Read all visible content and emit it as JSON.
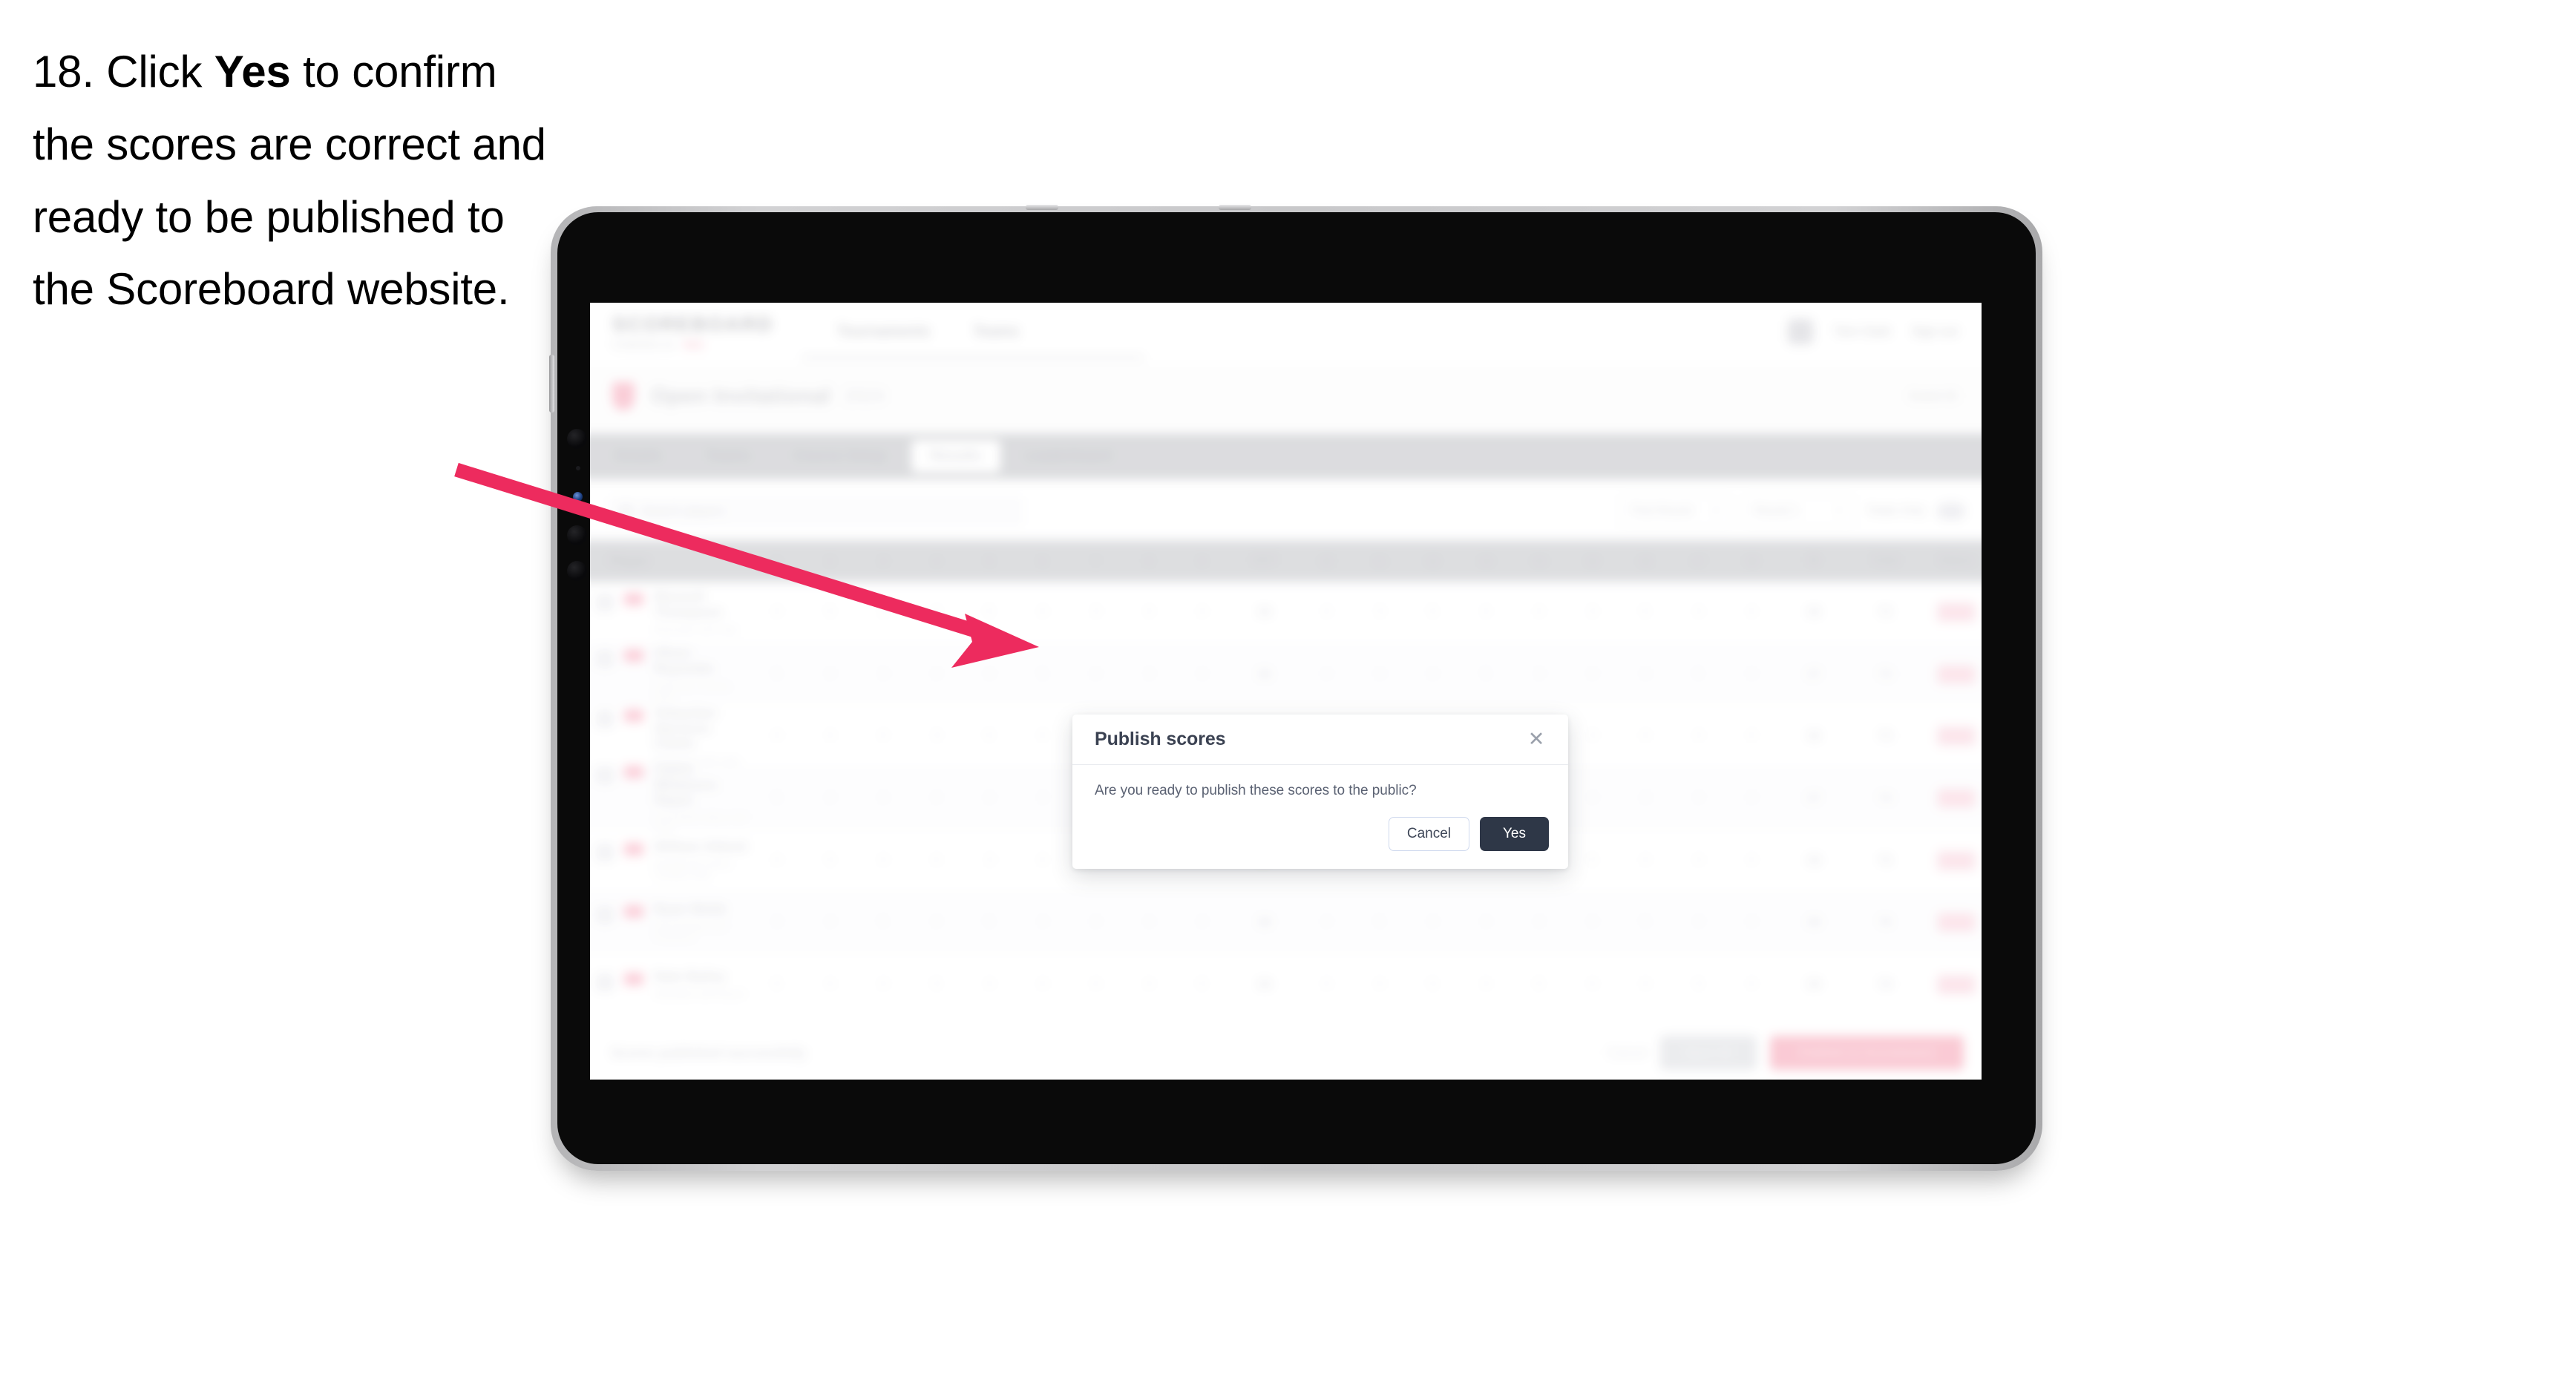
{
  "instruction": {
    "number": "18.",
    "before": " Click ",
    "bold": "Yes",
    "after": " to confirm the scores are correct and ready to be published to the Scoreboard website."
  },
  "annotation": {
    "arrow_color": "#ED2B5E",
    "points_to": "publish-scores-modal"
  },
  "device": {
    "type": "tablet",
    "bezel_color": "#0a0a0a",
    "frame_color": "#c8c8ca"
  },
  "app": {
    "nav": {
      "logo": "SCOREBOARD",
      "logo_sub": "POWERED BY",
      "logo_sub_accent": "RED",
      "links": [
        "Tournaments",
        "Teams"
      ],
      "user": "Tom Clark",
      "sign_out": "Sign out"
    },
    "page_title": {
      "title": "Open Invitational",
      "badge": "2024",
      "right_label": "Event ID"
    },
    "tabs": [
      {
        "label": "Details",
        "active": false
      },
      {
        "label": "Teams",
        "active": false
      },
      {
        "label": "Course Setup",
        "active": false
      },
      {
        "label": "Results",
        "active": true
      },
      {
        "label": "Leaderboard",
        "active": false
      }
    ],
    "filter_bar": {
      "search_placeholder": "Search players",
      "selects": [
        {
          "label": "First Round"
        },
        {
          "label": "Round 1"
        }
      ],
      "toggle_label": "Totals Only"
    },
    "table": {
      "columns": [
        "Player",
        "1",
        "2",
        "3",
        "4",
        "5",
        "6",
        "7",
        "8",
        "9",
        "OUT",
        "10",
        "11",
        "12",
        "13",
        "14",
        "15",
        "16",
        "17",
        "18",
        "IN",
        "Total",
        "Status"
      ],
      "rows": [
        {
          "player": "Maxwell Thompson",
          "club": "Riverside Golf Club",
          "scores": [
            "4",
            "5",
            "3",
            "4",
            "5",
            "4",
            "3",
            "4",
            "4"
          ],
          "out": "36",
          "scores_in": [
            "4",
            "3",
            "5",
            "4",
            "4",
            "3",
            "5",
            "4",
            "4"
          ],
          "in": "36",
          "total": "72",
          "status": "Final"
        },
        {
          "player": "Oliver Reynolds",
          "club": "Lakeview Country Club",
          "scores": [
            "5",
            "4",
            "3",
            "4",
            "4",
            "5",
            "4",
            "3",
            "4"
          ],
          "out": "36",
          "scores_in": [
            "4",
            "4",
            "4",
            "5",
            "3",
            "4",
            "4",
            "5",
            "4"
          ],
          "in": "37",
          "total": "73",
          "status": "Final"
        },
        {
          "player": "Sebastian Harrison-Clarke",
          "club": "Pinehurst Golf Links",
          "scores": [
            "4",
            "4",
            "4",
            "3",
            "5",
            "4",
            "4",
            "4",
            "5"
          ],
          "out": "37",
          "scores_in": [
            "4",
            "5",
            "4",
            "4",
            "4",
            "3",
            "4",
            "4",
            "4"
          ],
          "in": "36",
          "total": "73",
          "status": "Final"
        },
        {
          "player": "Calvin Whitmore-Hayes",
          "club": "Greenfield Valley Golf Club",
          "scores": [
            "5",
            "4",
            "4",
            "4",
            "4",
            "4",
            "3",
            "5",
            "4"
          ],
          "out": "37",
          "scores_in": [
            "5",
            "4",
            "4",
            "3",
            "5",
            "4",
            "4",
            "4",
            "4"
          ],
          "in": "37",
          "total": "74",
          "status": "Final"
        },
        {
          "player": "William Abbott",
          "club": "Northbrook Golf & Country Club",
          "scores": [
            "4",
            "5",
            "4",
            "4",
            "3",
            "4",
            "5",
            "4",
            "4"
          ],
          "out": "37",
          "scores_in": [
            "4",
            "4",
            "5",
            "4",
            "4",
            "5",
            "4",
            "4",
            "4"
          ],
          "in": "38",
          "total": "75",
          "status": "Final"
        },
        {
          "player": "Ryan Webb",
          "club": "Stonebridge Golf Academy",
          "scores": [
            "4",
            "4",
            "5",
            "4",
            "5",
            "4",
            "4",
            "4",
            "4"
          ],
          "out": "38",
          "scores_in": [
            "4",
            "5",
            "4",
            "4",
            "4",
            "4",
            "5",
            "4",
            "4"
          ],
          "in": "38",
          "total": "76",
          "status": "Final"
        },
        {
          "player": "Nate Bailey",
          "club": "Westfield Golf Resort",
          "scores": [
            "5",
            "4",
            "4",
            "5",
            "4",
            "4",
            "4",
            "4",
            "5"
          ],
          "out": "39",
          "scores_in": [
            "4",
            "4",
            "5",
            "4",
            "5",
            "4",
            "4",
            "5",
            "4"
          ],
          "in": "39",
          "total": "78",
          "status": "Final"
        }
      ]
    },
    "footer": {
      "note": "Scores published successfully",
      "link": "Cancel",
      "secondary_button": "Save All",
      "primary_button": "Publish to Scoreboard"
    }
  },
  "modal": {
    "title": "Publish scores",
    "close_icon": "close-icon",
    "message": "Are you ready to publish these scores to the public?",
    "cancel_label": "Cancel",
    "confirm_label": "Yes",
    "confirm_bg": "#2e3747",
    "cancel_border": "#cfd9ee"
  }
}
